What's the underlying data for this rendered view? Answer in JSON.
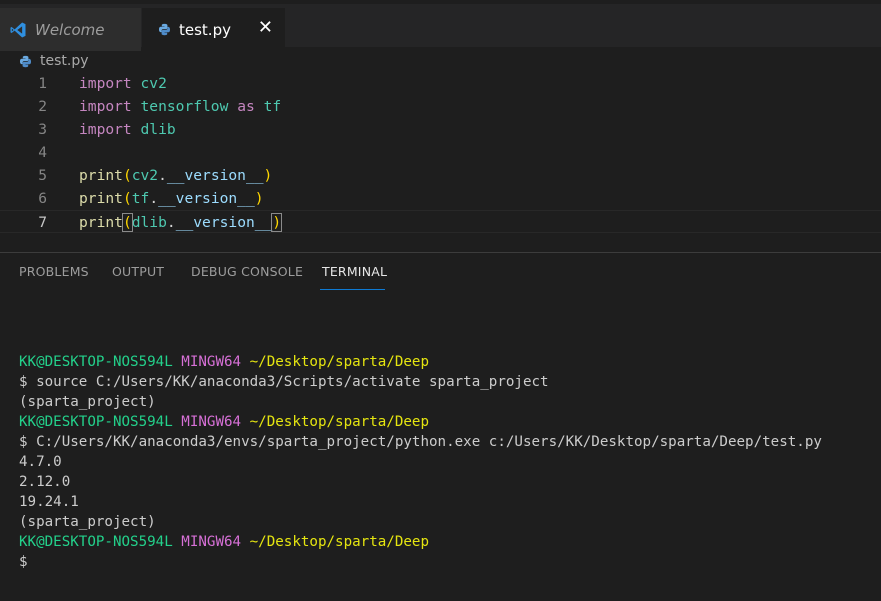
{
  "tabs": [
    {
      "label": "Welcome",
      "icon": "vscode-icon"
    },
    {
      "label": "test.py",
      "icon": "python-icon",
      "close": "✕"
    }
  ],
  "breadcrumb": {
    "label": "test.py",
    "icon": "python-icon"
  },
  "editor": {
    "line_numbers": [
      "1",
      "2",
      "3",
      "4",
      "5",
      "6",
      "7"
    ],
    "active_line": 7,
    "lines": [
      [
        {
          "t": "import",
          "c": "kw"
        },
        {
          "t": " "
        },
        {
          "t": "cv2",
          "c": "mod"
        }
      ],
      [
        {
          "t": "import",
          "c": "kw"
        },
        {
          "t": " "
        },
        {
          "t": "tensorflow",
          "c": "mod"
        },
        {
          "t": " "
        },
        {
          "t": "as",
          "c": "kw"
        },
        {
          "t": " "
        },
        {
          "t": "tf",
          "c": "mod"
        }
      ],
      [
        {
          "t": "import",
          "c": "kw"
        },
        {
          "t": " "
        },
        {
          "t": "dlib",
          "c": "mod"
        }
      ],
      [],
      [
        {
          "t": "print",
          "c": "fn"
        },
        {
          "t": "(",
          "c": "paren"
        },
        {
          "t": "cv2",
          "c": "mod"
        },
        {
          "t": ".",
          "c": "dot"
        },
        {
          "t": "__version__",
          "c": "attr"
        },
        {
          "t": ")",
          "c": "paren"
        }
      ],
      [
        {
          "t": "print",
          "c": "fn"
        },
        {
          "t": "(",
          "c": "paren"
        },
        {
          "t": "tf",
          "c": "mod"
        },
        {
          "t": ".",
          "c": "dot"
        },
        {
          "t": "__version__",
          "c": "attr"
        },
        {
          "t": ")",
          "c": "paren"
        }
      ],
      [
        {
          "t": "print",
          "c": "fn"
        },
        {
          "t": "(",
          "c": "paren bracket-match"
        },
        {
          "t": "dlib",
          "c": "mod"
        },
        {
          "t": ".",
          "c": "dot"
        },
        {
          "t": "__version__",
          "c": "attr"
        },
        {
          "t": ")",
          "c": "paren bracket-match"
        }
      ]
    ]
  },
  "panel": {
    "tabs": [
      "PROBLEMS",
      "OUTPUT",
      "DEBUG CONSOLE",
      "TERMINAL"
    ],
    "active_tab": "TERMINAL"
  },
  "terminal": {
    "lines": [
      [
        {
          "t": "KK@DESKTOP-NOS594L",
          "c": "t-green"
        },
        {
          "t": " "
        },
        {
          "t": "MINGW64",
          "c": "t-magenta"
        },
        {
          "t": " "
        },
        {
          "t": "~/Desktop/sparta/Deep",
          "c": "t-yellow"
        }
      ],
      [
        {
          "t": "$ source C:/Users/KK/anaconda3/Scripts/activate sparta_project"
        }
      ],
      [
        {
          "t": "(sparta_project)"
        }
      ],
      [
        {
          "t": "KK@DESKTOP-NOS594L",
          "c": "t-green"
        },
        {
          "t": " "
        },
        {
          "t": "MINGW64",
          "c": "t-magenta"
        },
        {
          "t": " "
        },
        {
          "t": "~/Desktop/sparta/Deep",
          "c": "t-yellow"
        }
      ],
      [
        {
          "t": "$ C:/Users/KK/anaconda3/envs/sparta_project/python.exe c:/Users/KK/Desktop/sparta/Deep/test.py"
        }
      ],
      [
        {
          "t": "4.7.0"
        }
      ],
      [
        {
          "t": "2.12.0"
        }
      ],
      [
        {
          "t": "19.24.1"
        }
      ],
      [
        {
          "t": "(sparta_project)"
        }
      ],
      [
        {
          "t": "KK@DESKTOP-NOS594L",
          "c": "t-green"
        },
        {
          "t": " "
        },
        {
          "t": "MINGW64",
          "c": "t-magenta"
        },
        {
          "t": " "
        },
        {
          "t": "~/Desktop/sparta/Deep",
          "c": "t-yellow"
        }
      ],
      [
        {
          "t": "$"
        }
      ]
    ]
  },
  "colors": {
    "background": "#1e1e1e",
    "tab_inactive": "#2d2d2d",
    "tab_accent": "#0e7ad3",
    "keyword": "#c586c0",
    "module": "#4ec9b0",
    "function": "#dcdcaa",
    "bracket": "#ffd700",
    "variable": "#9cdcfe",
    "terminal_green": "#23d18b",
    "terminal_magenta": "#d670d6",
    "terminal_yellow": "#e5e510"
  }
}
